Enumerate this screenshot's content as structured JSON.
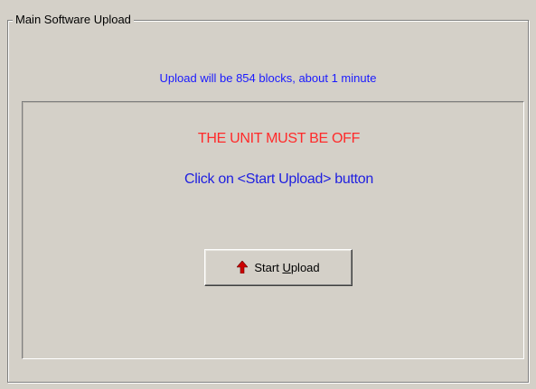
{
  "group": {
    "title": "Main Software Upload"
  },
  "upload_info": "Upload will be 854 blocks, about 1 minute",
  "panel": {
    "warning": "THE UNIT MUST BE OFF",
    "instruction": "Click on <Start Upload> button"
  },
  "start_button": {
    "label_prefix": "Start ",
    "label_accel": "U",
    "label_suffix": "pload",
    "icon": "red-up-arrow-icon"
  },
  "colors": {
    "background": "#d4d0c8",
    "info_text": "#1a1aff",
    "warning_text": "#ff2a2a",
    "instruction_text": "#2020e0",
    "arrow": "#cc0000"
  }
}
